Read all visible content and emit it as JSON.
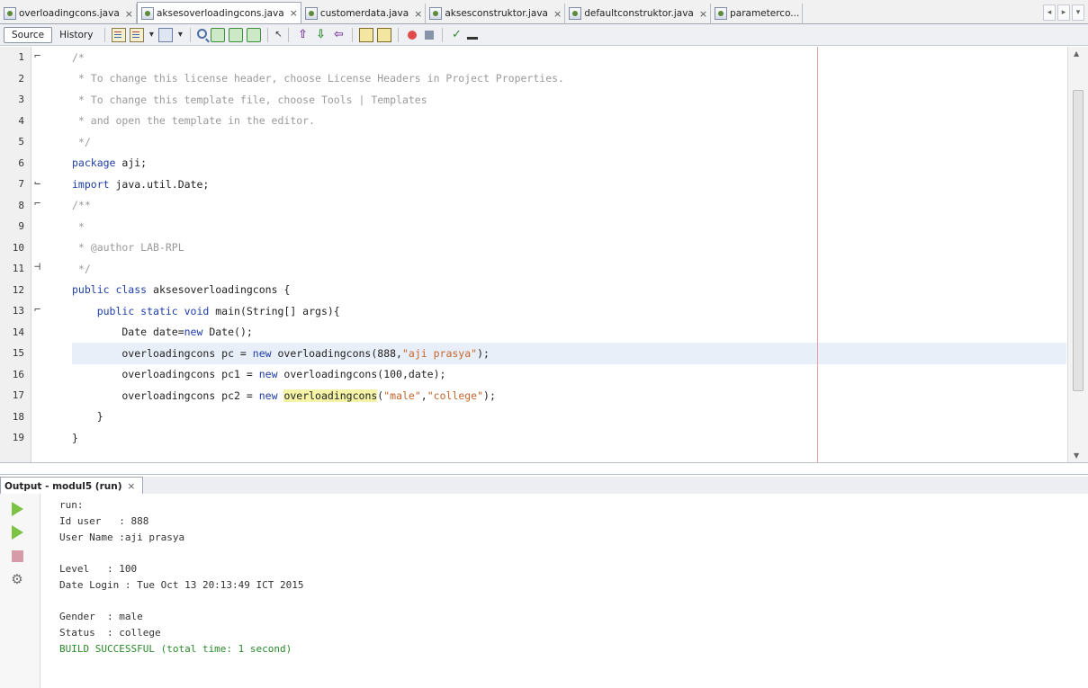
{
  "tabs": [
    {
      "label": "overloadingcons.java",
      "active": false
    },
    {
      "label": "aksesoverloadingcons.java",
      "active": true
    },
    {
      "label": "customerdata.java",
      "active": false
    },
    {
      "label": "aksesconstruktor.java",
      "active": false
    },
    {
      "label": "defaultconstruktor.java",
      "active": false
    },
    {
      "label": "parameterco...",
      "active": false
    }
  ],
  "tab_close_glyph": "×",
  "tab_controls": [
    "◂",
    "▸",
    "▾"
  ],
  "toolbar": {
    "source_label": "Source",
    "history_label": "History",
    "icons": [
      "prev-edit-icon",
      "back-icon",
      "forward-icon",
      "find-icon",
      "find-prev-icon",
      "find-next-icon",
      "toggle-highlight-icon",
      "toggle-bookmark-icon",
      "prev-bookmark-icon",
      "next-bookmark-icon",
      "shift-left-icon",
      "shift-right-icon",
      "comment-icon",
      "uncomment-icon",
      "record-macro-icon",
      "stop-macro-icon",
      "diff-icon",
      "macro-icon"
    ]
  },
  "editor": {
    "line_numbers": [
      "1",
      "2",
      "3",
      "4",
      "5",
      "6",
      "7",
      "8",
      "9",
      "10",
      "11",
      "12",
      "13",
      "14",
      "15",
      "16",
      "17",
      "18",
      "19"
    ],
    "lines": [
      [
        {
          "t": "/*",
          "c": "cmt"
        }
      ],
      [
        {
          "t": " * To change this license header, choose License Headers in Project Properties.",
          "c": "cmt"
        }
      ],
      [
        {
          "t": " * To change this template file, choose Tools | Templates",
          "c": "cmt"
        }
      ],
      [
        {
          "t": " * and open the template in the editor.",
          "c": "cmt"
        }
      ],
      [
        {
          "t": " */",
          "c": "cmt"
        }
      ],
      [
        {
          "t": "package",
          "c": "kw"
        },
        {
          "t": " aji;",
          "c": ""
        }
      ],
      [
        {
          "t": "import",
          "c": "kw"
        },
        {
          "t": " java.util.Date;",
          "c": ""
        }
      ],
      [
        {
          "t": "/**",
          "c": "cmt"
        }
      ],
      [
        {
          "t": " *",
          "c": "cmt"
        }
      ],
      [
        {
          "t": " * @author LAB-RPL",
          "c": "cmt"
        }
      ],
      [
        {
          "t": " */",
          "c": "cmt"
        }
      ],
      [
        {
          "t": "public class",
          "c": "kw"
        },
        {
          "t": " aksesoverloadingcons {",
          "c": ""
        }
      ],
      [
        {
          "t": "    ",
          "c": ""
        },
        {
          "t": "public static void",
          "c": "kw"
        },
        {
          "t": " main(String[] args){",
          "c": ""
        }
      ],
      [
        {
          "t": "        Date date=",
          "c": ""
        },
        {
          "t": "new",
          "c": "kw"
        },
        {
          "t": " Date();",
          "c": ""
        }
      ],
      [
        {
          "t": "        overloadingcons pc = ",
          "c": ""
        },
        {
          "t": "new",
          "c": "kw"
        },
        {
          "t": " overloadingcons(888,",
          "c": ""
        },
        {
          "t": "\"aji prasya\"",
          "c": "str"
        },
        {
          "t": ");",
          "c": ""
        }
      ],
      [
        {
          "t": "        overloadingcons pc1 = ",
          "c": ""
        },
        {
          "t": "new",
          "c": "kw"
        },
        {
          "t": " overloadingcons(100,date);",
          "c": ""
        }
      ],
      [
        {
          "t": "        overloadingcons pc2 = ",
          "c": ""
        },
        {
          "t": "new",
          "c": "kw"
        },
        {
          "t": " ",
          "c": ""
        },
        {
          "t": "overloadingcons",
          "c": "warnhl"
        },
        {
          "t": "(",
          "c": ""
        },
        {
          "t": "\"male\"",
          "c": "str"
        },
        {
          "t": ",",
          "c": ""
        },
        {
          "t": "\"college\"",
          "c": "str"
        },
        {
          "t": ");",
          "c": ""
        }
      ],
      [
        {
          "t": "    }",
          "c": ""
        }
      ],
      [
        {
          "t": "}",
          "c": ""
        }
      ]
    ],
    "highlight_line": 15
  },
  "output": {
    "tab_label": "Output - modul5 (run)",
    "buttons": [
      "rerun-icon",
      "rerun-params-icon",
      "stop-icon",
      "settings-icon"
    ],
    "lines": [
      {
        "t": "run:",
        "c": ""
      },
      {
        "t": "Id user   : 888",
        "c": ""
      },
      {
        "t": "User Name :aji prasya",
        "c": ""
      },
      {
        "t": "",
        "c": ""
      },
      {
        "t": "Level   : 100",
        "c": ""
      },
      {
        "t": "Date Login : Tue Oct 13 20:13:49 ICT 2015",
        "c": ""
      },
      {
        "t": "",
        "c": ""
      },
      {
        "t": "Gender  : male",
        "c": ""
      },
      {
        "t": "Status  : college",
        "c": ""
      },
      {
        "t": "BUILD SUCCESSFUL (total time: 1 second)",
        "c": "success"
      }
    ]
  }
}
